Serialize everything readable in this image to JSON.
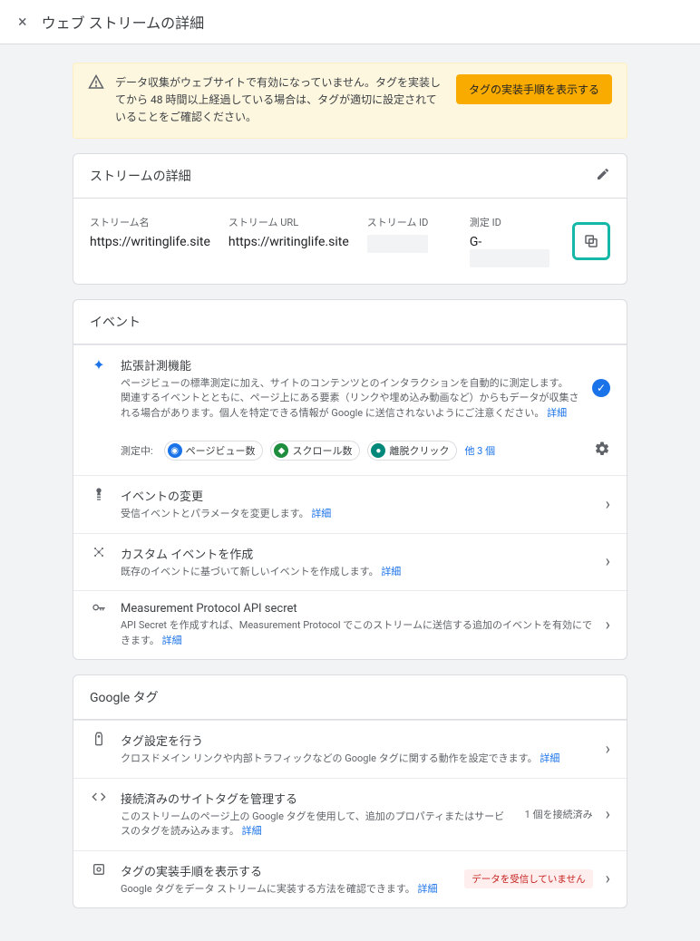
{
  "header": {
    "title": "ウェブ ストリームの詳細"
  },
  "warning": {
    "text": "データ収集がウェブサイトで有効になっていません。タグを実装してから 48 時間以上経過している場合は、タグが適切に設定されていることをご確認ください。",
    "button": "タグの実装手順を表示する"
  },
  "stream_details": {
    "section_title": "ストリームの詳細",
    "cols": {
      "name_label": "ストリーム名",
      "name_value": "https://writinglife.site",
      "url_label": "ストリーム URL",
      "url_value": "https://writinglife.site",
      "id_label": "ストリーム ID",
      "id_value": "",
      "measurement_label": "測定 ID",
      "measurement_value": "G-"
    }
  },
  "events": {
    "section_title": "イベント",
    "enhanced": {
      "title": "拡張計測機能",
      "desc1": "ページビューの標準測定に加え、サイトのコンテンツとのインタラクションを自動的に測定します。",
      "desc2": "関連するイベントとともに、ページ上にある要素（リンクや埋め込み動画など）からもデータが収集される場合があります。個人を特定できる情報が Google に送信されないようにご注意ください。",
      "link": "詳細",
      "measuring_label": "測定中:",
      "chips": {
        "pageview": "ページビュー数",
        "scroll": "スクロール数",
        "click": "離脱クリック",
        "more": "他 3 個"
      }
    },
    "modify": {
      "title": "イベントの変更",
      "desc": "受信イベントとパラメータを変更します。",
      "link": "詳細"
    },
    "custom": {
      "title": "カスタム イベントを作成",
      "desc": "既存のイベントに基づいて新しいイベントを作成します。",
      "link": "詳細"
    },
    "api": {
      "title": "Measurement Protocol API secret",
      "desc": "API Secret を作成すれば、Measurement Protocol でこのストリームに送信する追加のイベントを有効にできます。",
      "link": "詳細"
    }
  },
  "gtag": {
    "section_title": "Google タグ",
    "settings": {
      "title": "タグ設定を行う",
      "desc": "クロスドメイン リンクや内部トラフィックなどの Google タグに関する動作を設定できます。",
      "link": "詳細"
    },
    "connected": {
      "title": "接続済みのサイトタグを管理する",
      "desc": "このストリームのページ上の Google タグを使用して、追加のプロパティまたはサービスのタグを読み込みます。",
      "link": "詳細",
      "badge": "1 個を接続済み"
    },
    "install": {
      "title": "タグの実装手順を表示する",
      "desc": "Google タグをデータ ストリームに実装する方法を確認できます。",
      "link": "詳細",
      "badge": "データを受信していません"
    }
  }
}
